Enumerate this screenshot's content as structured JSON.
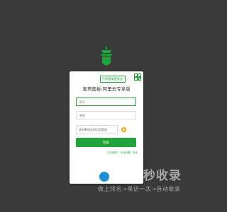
{
  "panel": {
    "qr_tip": "扫码登录更安全",
    "title": "宝塔面板-阿里云专享版",
    "username_placeholder": "账号",
    "password_placeholder": "密码",
    "captcha_value": "请完整验证码后再登录",
    "login_label": "登录",
    "links": [
      "忘记密码?",
      "安全设置",
      "关闭"
    ]
  },
  "watermark": {
    "title": "自动秒收录",
    "slogan": "做上排名→来访一次→自动收录"
  },
  "colors": {
    "background": "#3a3a3a",
    "accent": "#20a53a",
    "card": "#ffffff"
  }
}
